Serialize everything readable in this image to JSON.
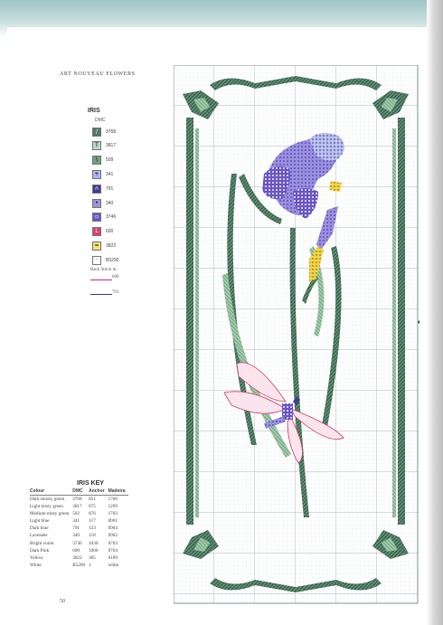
{
  "header": {
    "section": "ART NOUVEAU FLOWERS"
  },
  "legend": {
    "title": "IRIS",
    "thread_brand": "DMC",
    "items": [
      {
        "symbol": "/",
        "code": "3768",
        "color": "#4f7a6a"
      },
      {
        "symbol": "T",
        "code": "3817",
        "color": "#b7d8c0"
      },
      {
        "symbol": "\\",
        "code": "509",
        "color": "#6fa27e"
      },
      {
        "symbol": "+",
        "code": "341",
        "color": "#aab6ee"
      },
      {
        "symbol": "∩",
        "code": "791",
        "color": "#3a3e8c"
      },
      {
        "symbol": "•",
        "code": "340",
        "color": "#9c93d8"
      },
      {
        "symbol": "▫",
        "code": "3746",
        "color": "#6c58c4"
      },
      {
        "symbol": "L",
        "code": "600",
        "color": "#e0406a"
      },
      {
        "symbol": "=",
        "code": "3822",
        "color": "#f2e07a"
      },
      {
        "symbol": "·",
        "code": "B5200",
        "color": "#ffffff"
      }
    ],
    "backstitch_label": "Back Stitch in:",
    "backstitch": [
      {
        "code": "600",
        "color": "#d23c6c"
      },
      {
        "code": "791",
        "color": "#3a3e8c"
      }
    ]
  },
  "key": {
    "title": "IRIS KEY",
    "columns": [
      "Colour",
      "DMC",
      "Anchor",
      "Madeira"
    ],
    "rows": [
      [
        "Dark smoky green",
        "3768",
        "851",
        "1706"
      ],
      [
        "Light misty green",
        "3817",
        "875",
        "1209"
      ],
      [
        "Medium misty green",
        "502",
        "876",
        "1703"
      ],
      [
        "Light blue",
        "341",
        "117",
        "0901"
      ],
      [
        "Dark blue",
        "791",
        "123",
        "0904"
      ],
      [
        "Lavender",
        "340",
        "118",
        "0902"
      ],
      [
        "Bright violet",
        "3746",
        "1030",
        "0703"
      ],
      [
        "Dark Pink",
        "600",
        "1006",
        "0704"
      ],
      [
        "Yellow",
        "3822",
        "305",
        "0109"
      ],
      [
        "White",
        "B5200",
        "1",
        "white"
      ]
    ]
  },
  "page_number": "50"
}
